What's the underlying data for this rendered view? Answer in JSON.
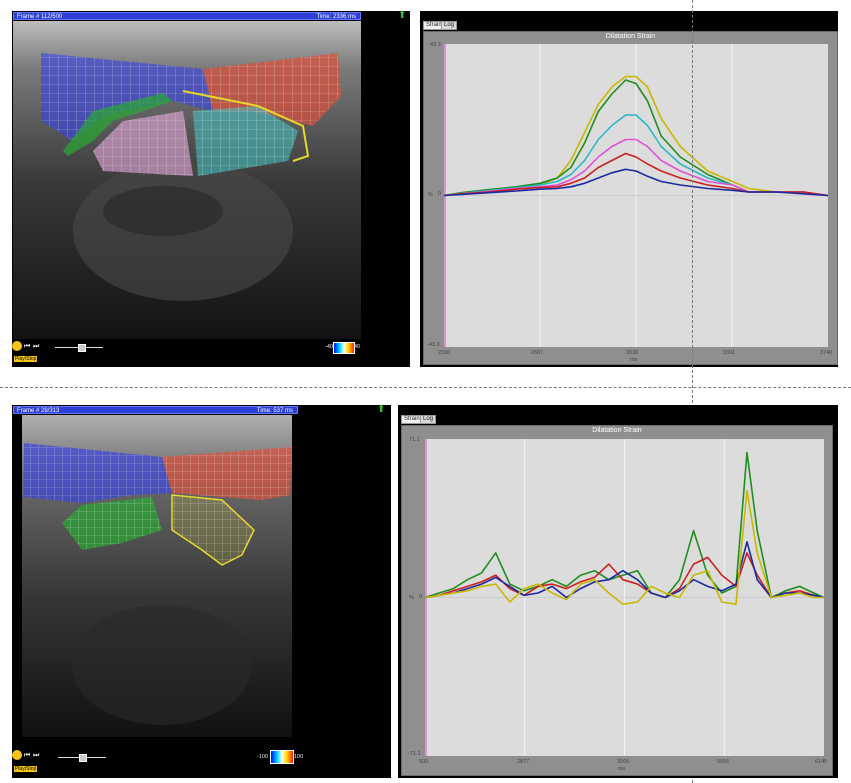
{
  "top": {
    "frame_label": "Frame # 112/500",
    "time_label": "Time: 2336 ms",
    "tabs": [
      "Strain",
      "Log"
    ],
    "chart_title": "Dilatation Strain",
    "play_label": "Play/Stop",
    "colorbar_min": "-40",
    "colorbar_max": "40",
    "ymax_label": "43.3",
    "ymin_label": "-43.3",
    "yunit": "%",
    "yzero": "0",
    "x_ticks": [
      "2336",
      "2687",
      "3038",
      "3391",
      "3740"
    ],
    "xunit": "ms"
  },
  "bottom": {
    "frame_label": "Frame # 28/313",
    "time_label": "Time: 537 ms",
    "tabs": [
      "Strain",
      "Log"
    ],
    "chart_title": "Dilatation Strain",
    "play_label": "Play/Stop",
    "colorbar_min": "-100",
    "colorbar_max": "100",
    "ymax_label": "71.1",
    "ymin_label": "-71.1",
    "yunit": "%",
    "yzero": "0",
    "x_ticks": [
      "500",
      "2877",
      "3506",
      "5056",
      "6145"
    ],
    "xunit": "ms"
  },
  "chart_data": [
    {
      "type": "line",
      "title": "Dilatation Strain",
      "xlabel": "ms",
      "ylabel": "%",
      "ylim": [
        -43.3,
        43.3
      ],
      "xlim": [
        2336,
        3740
      ],
      "grid": true,
      "series": [
        {
          "color": "#c9b800",
          "x": [
            2336,
            2400,
            2500,
            2600,
            2687,
            2750,
            2800,
            2850,
            2900,
            2950,
            3000,
            3038,
            3080,
            3130,
            3200,
            3300,
            3391,
            3450,
            3550,
            3650,
            3740
          ],
          "values": [
            0,
            0.8,
            1.5,
            2.3,
            3,
            5,
            10,
            18,
            26,
            31,
            34,
            34,
            31,
            22,
            14,
            7,
            4,
            2,
            1,
            1,
            0
          ]
        },
        {
          "color": "#1f8e1f",
          "x": [
            2336,
            2400,
            2500,
            2600,
            2687,
            2750,
            2800,
            2850,
            2900,
            2950,
            3000,
            3038,
            3080,
            3130,
            3200,
            3300,
            3391,
            3450,
            3550,
            3650,
            3740
          ],
          "values": [
            0,
            0.8,
            1.7,
            2.5,
            3.5,
            5,
            8,
            15,
            24,
            29,
            33,
            32,
            27,
            17,
            11,
            6,
            3,
            1,
            1,
            1,
            0
          ]
        },
        {
          "color": "#2ab8c8",
          "x": [
            2336,
            2400,
            2500,
            2600,
            2687,
            2750,
            2800,
            2850,
            2900,
            2950,
            3000,
            3038,
            3080,
            3130,
            3200,
            3300,
            3391,
            3450,
            3550,
            3650,
            3740
          ],
          "values": [
            0,
            0.6,
            1.4,
            2.2,
            3,
            4,
            6,
            10,
            16,
            20,
            23,
            23,
            20,
            14,
            9,
            5,
            3,
            1,
            1,
            1,
            0
          ]
        },
        {
          "color": "#e050d8",
          "x": [
            2336,
            2400,
            2500,
            2600,
            2687,
            2750,
            2800,
            2850,
            2900,
            2950,
            3000,
            3038,
            3080,
            3130,
            3200,
            3300,
            3391,
            3450,
            3550,
            3650,
            3740
          ],
          "values": [
            0,
            0.5,
            1.2,
            2,
            2.5,
            3,
            4.5,
            7,
            11,
            14,
            16,
            16,
            14,
            10,
            7,
            4,
            3,
            1,
            1,
            1,
            0
          ]
        },
        {
          "color": "#cc2020",
          "x": [
            2336,
            2400,
            2500,
            2600,
            2687,
            2750,
            2800,
            2850,
            2900,
            2950,
            3000,
            3038,
            3080,
            3130,
            3200,
            3300,
            3391,
            3450,
            3550,
            3650,
            3740
          ],
          "values": [
            0,
            0.5,
            1,
            1.8,
            2.3,
            2.5,
            3.5,
            5,
            8,
            10,
            12,
            11,
            9,
            7,
            5,
            3,
            2,
            1,
            1,
            1,
            0
          ]
        },
        {
          "color": "#1a2aa0",
          "x": [
            2336,
            2400,
            2500,
            2600,
            2687,
            2750,
            2800,
            2850,
            2900,
            2950,
            3000,
            3038,
            3080,
            3130,
            3200,
            3300,
            3391,
            3450,
            3550,
            3650,
            3740
          ],
          "values": [
            0,
            0.3,
            0.8,
            1.3,
            1.8,
            2,
            2.5,
            3.5,
            5,
            6.5,
            7.5,
            7,
            5.5,
            4,
            3,
            2,
            1.5,
            1,
            1,
            0.5,
            0
          ]
        }
      ]
    },
    {
      "type": "line",
      "title": "Dilatation Strain",
      "xlabel": "ms",
      "ylabel": "%",
      "ylim": [
        -71.1,
        71.1
      ],
      "xlim": [
        500,
        6145
      ],
      "grid": true,
      "series": [
        {
          "color": "#1f8e1f",
          "x": [
            500,
            700,
            900,
            1100,
            1300,
            1500,
            1700,
            1900,
            2100,
            2300,
            2500,
            2700,
            2900,
            3100,
            3300,
            3506,
            3700,
            3900,
            4100,
            4300,
            4500,
            4700,
            4900,
            5056,
            5200,
            5400,
            5600,
            5800,
            6000,
            6145
          ],
          "values": [
            0,
            2,
            4,
            8,
            11,
            20,
            6,
            3,
            5,
            8,
            5,
            10,
            12,
            8,
            10,
            12,
            2,
            0,
            8,
            30,
            10,
            2,
            5,
            65,
            30,
            0,
            3,
            5,
            2,
            0
          ]
        },
        {
          "color": "#cc2020",
          "x": [
            500,
            700,
            900,
            1100,
            1300,
            1500,
            1700,
            1900,
            2100,
            2300,
            2500,
            2700,
            2900,
            3100,
            3300,
            3506,
            3700,
            3900,
            4100,
            4300,
            4500,
            4700,
            4900,
            5056,
            5200,
            5400,
            5600,
            5800,
            6000,
            6145
          ],
          "values": [
            0,
            1,
            3,
            5,
            7,
            10,
            4,
            1,
            5,
            6,
            4,
            7,
            9,
            15,
            8,
            6,
            2,
            0,
            4,
            15,
            18,
            10,
            5,
            20,
            10,
            0,
            2,
            3,
            1,
            0
          ]
        },
        {
          "color": "#1a2aa0",
          "x": [
            500,
            700,
            900,
            1100,
            1300,
            1500,
            1700,
            1900,
            2100,
            2300,
            2500,
            2700,
            2900,
            3100,
            3300,
            3506,
            3700,
            3900,
            4100,
            4300,
            4500,
            4700,
            4900,
            5056,
            5200,
            5400,
            5600,
            5800,
            6000,
            6145
          ],
          "values": [
            0,
            1,
            2,
            4,
            6,
            9,
            5,
            1,
            2,
            5,
            0,
            4,
            7,
            8,
            12,
            8,
            2,
            0,
            3,
            8,
            5,
            3,
            6,
            25,
            8,
            0,
            2,
            2,
            1,
            0
          ]
        },
        {
          "color": "#c9b800",
          "x": [
            500,
            700,
            900,
            1100,
            1300,
            1500,
            1700,
            1900,
            2100,
            2300,
            2500,
            2700,
            2900,
            3100,
            3300,
            3506,
            3700,
            3900,
            4100,
            4300,
            4500,
            4700,
            4900,
            5056,
            5200,
            5400,
            5600,
            5800,
            6000,
            6145
          ],
          "values": [
            0,
            1,
            2,
            3,
            5,
            6,
            -2,
            4,
            6,
            2,
            -1,
            6,
            8,
            2,
            -3,
            -2,
            5,
            2,
            0,
            10,
            12,
            -2,
            -3,
            48,
            20,
            0,
            1,
            2,
            0,
            0
          ]
        }
      ]
    }
  ]
}
